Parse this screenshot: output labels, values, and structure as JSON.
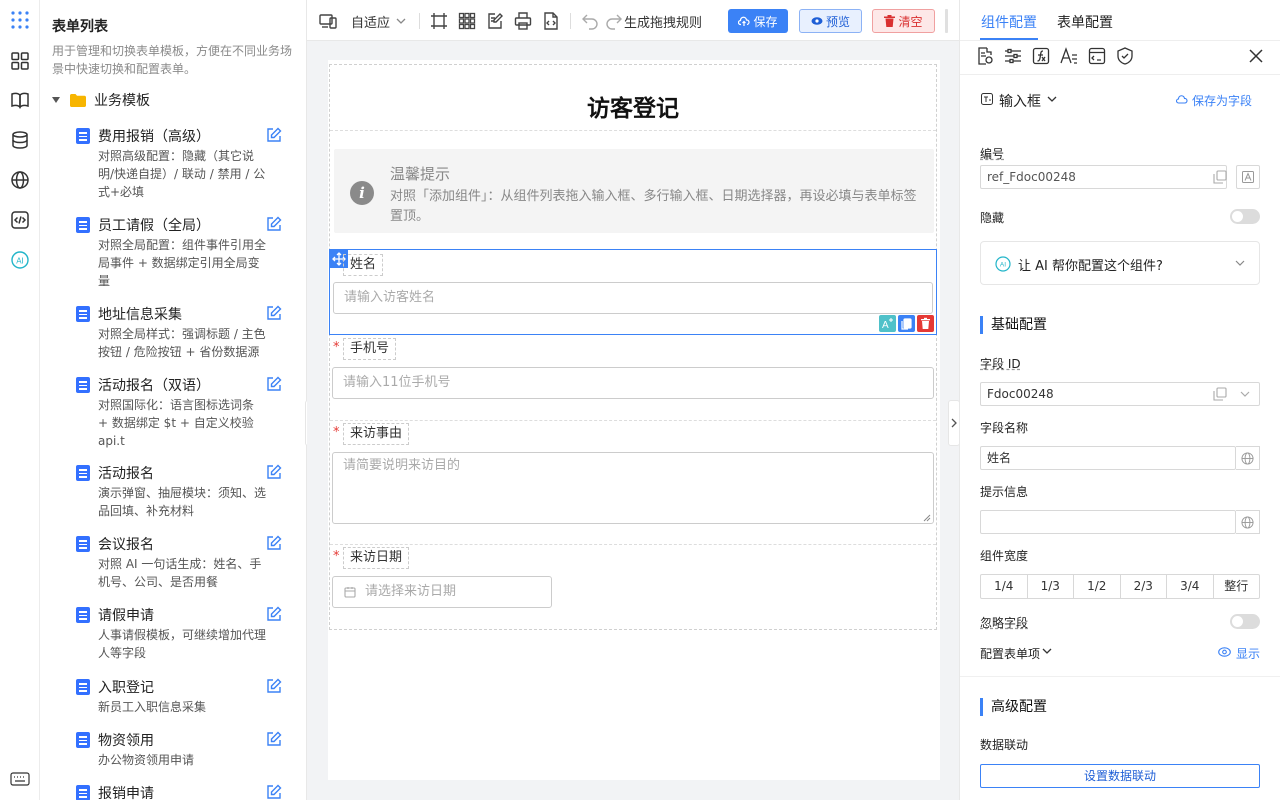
{
  "left": {
    "title": "表单列表",
    "desc": "用于管理和切换表单模板，方便在不同业务场景中快速切换和配置表单。",
    "folder": "业务模板",
    "templates": [
      {
        "name": "费用报销（高级）",
        "desc": "对照高级配置：隐藏（其它说明/快递自提）/ 联动 / 禁用 / 公式+必填"
      },
      {
        "name": "员工请假（全局）",
        "desc": "对照全局配置：组件事件引用全局事件 + 数据绑定引用全局变量"
      },
      {
        "name": "地址信息采集",
        "desc": "对照全局样式：强调标题 / 主色按钮 / 危险按钮 + 省份数据源"
      },
      {
        "name": "活动报名（双语）",
        "desc": "对照国际化：语言图标选词条 + 数据绑定 $t + 自定义校验 api.t"
      },
      {
        "name": "活动报名",
        "desc": "演示弹窗、抽屉模块：须知、选品回填、补充材料"
      },
      {
        "name": "会议报名",
        "desc": "对照 AI 一句话生成：姓名、手机号、公司、是否用餐"
      },
      {
        "name": "请假申请",
        "desc": "人事请假模板，可继续增加代理人等字段"
      },
      {
        "name": "入职登记",
        "desc": "新员工入职信息采集"
      },
      {
        "name": "物资领用",
        "desc": "办公物资领用申请"
      },
      {
        "name": "报销申请",
        "desc": ""
      }
    ]
  },
  "toolbar": {
    "layout_mode": "自适应",
    "rule_label": "生成拖拽规则",
    "save": "保存",
    "preview": "预览",
    "clear": "清空"
  },
  "form": {
    "title": "访客登记",
    "tip_title": "温馨提示",
    "tip_text": "对照「添加组件」：从组件列表拖入输入框、多行输入框、日期选择器，再设必填与表单标签置顶。",
    "fields": [
      {
        "label": "姓名",
        "placeholder": "请输入访客姓名",
        "required": false
      },
      {
        "label": "手机号",
        "placeholder": "请输入11位手机号",
        "required": true
      },
      {
        "label": "来访事由",
        "placeholder": "请简要说明来访目的",
        "required": true
      },
      {
        "label": "来访日期",
        "placeholder": "请选择来访日期",
        "required": true
      }
    ],
    "required_mark": "*"
  },
  "right": {
    "tab_component": "组件配置",
    "tab_form": "表单配置",
    "component_type": "输入框",
    "save_as_field": "保存为字段",
    "id_label": "编号",
    "id_value": "ref_Fdoc00248",
    "hidden_label": "隐藏",
    "ai_prompt": "让 AI 帮你配置这个组件?",
    "basic_section": "基础配置",
    "field_id_label": "字段 ID",
    "field_id_value": "Fdoc00248",
    "field_name_label": "字段名称",
    "field_name_value": "姓名",
    "hint_label": "提示信息",
    "hint_value": "",
    "width_label": "组件宽度",
    "widths": [
      "1/4",
      "1/3",
      "1/2",
      "2/3",
      "3/4",
      "整行"
    ],
    "ignore_label": "忽略字段",
    "config_items_label": "配置表单项",
    "show_label": "显示",
    "advanced_section": "高级配置",
    "linkage_label": "数据联动",
    "linkage_button": "设置数据联动"
  },
  "colors": {
    "accent": "#3b82f6",
    "danger": "#d93030",
    "required": "#e53935"
  }
}
